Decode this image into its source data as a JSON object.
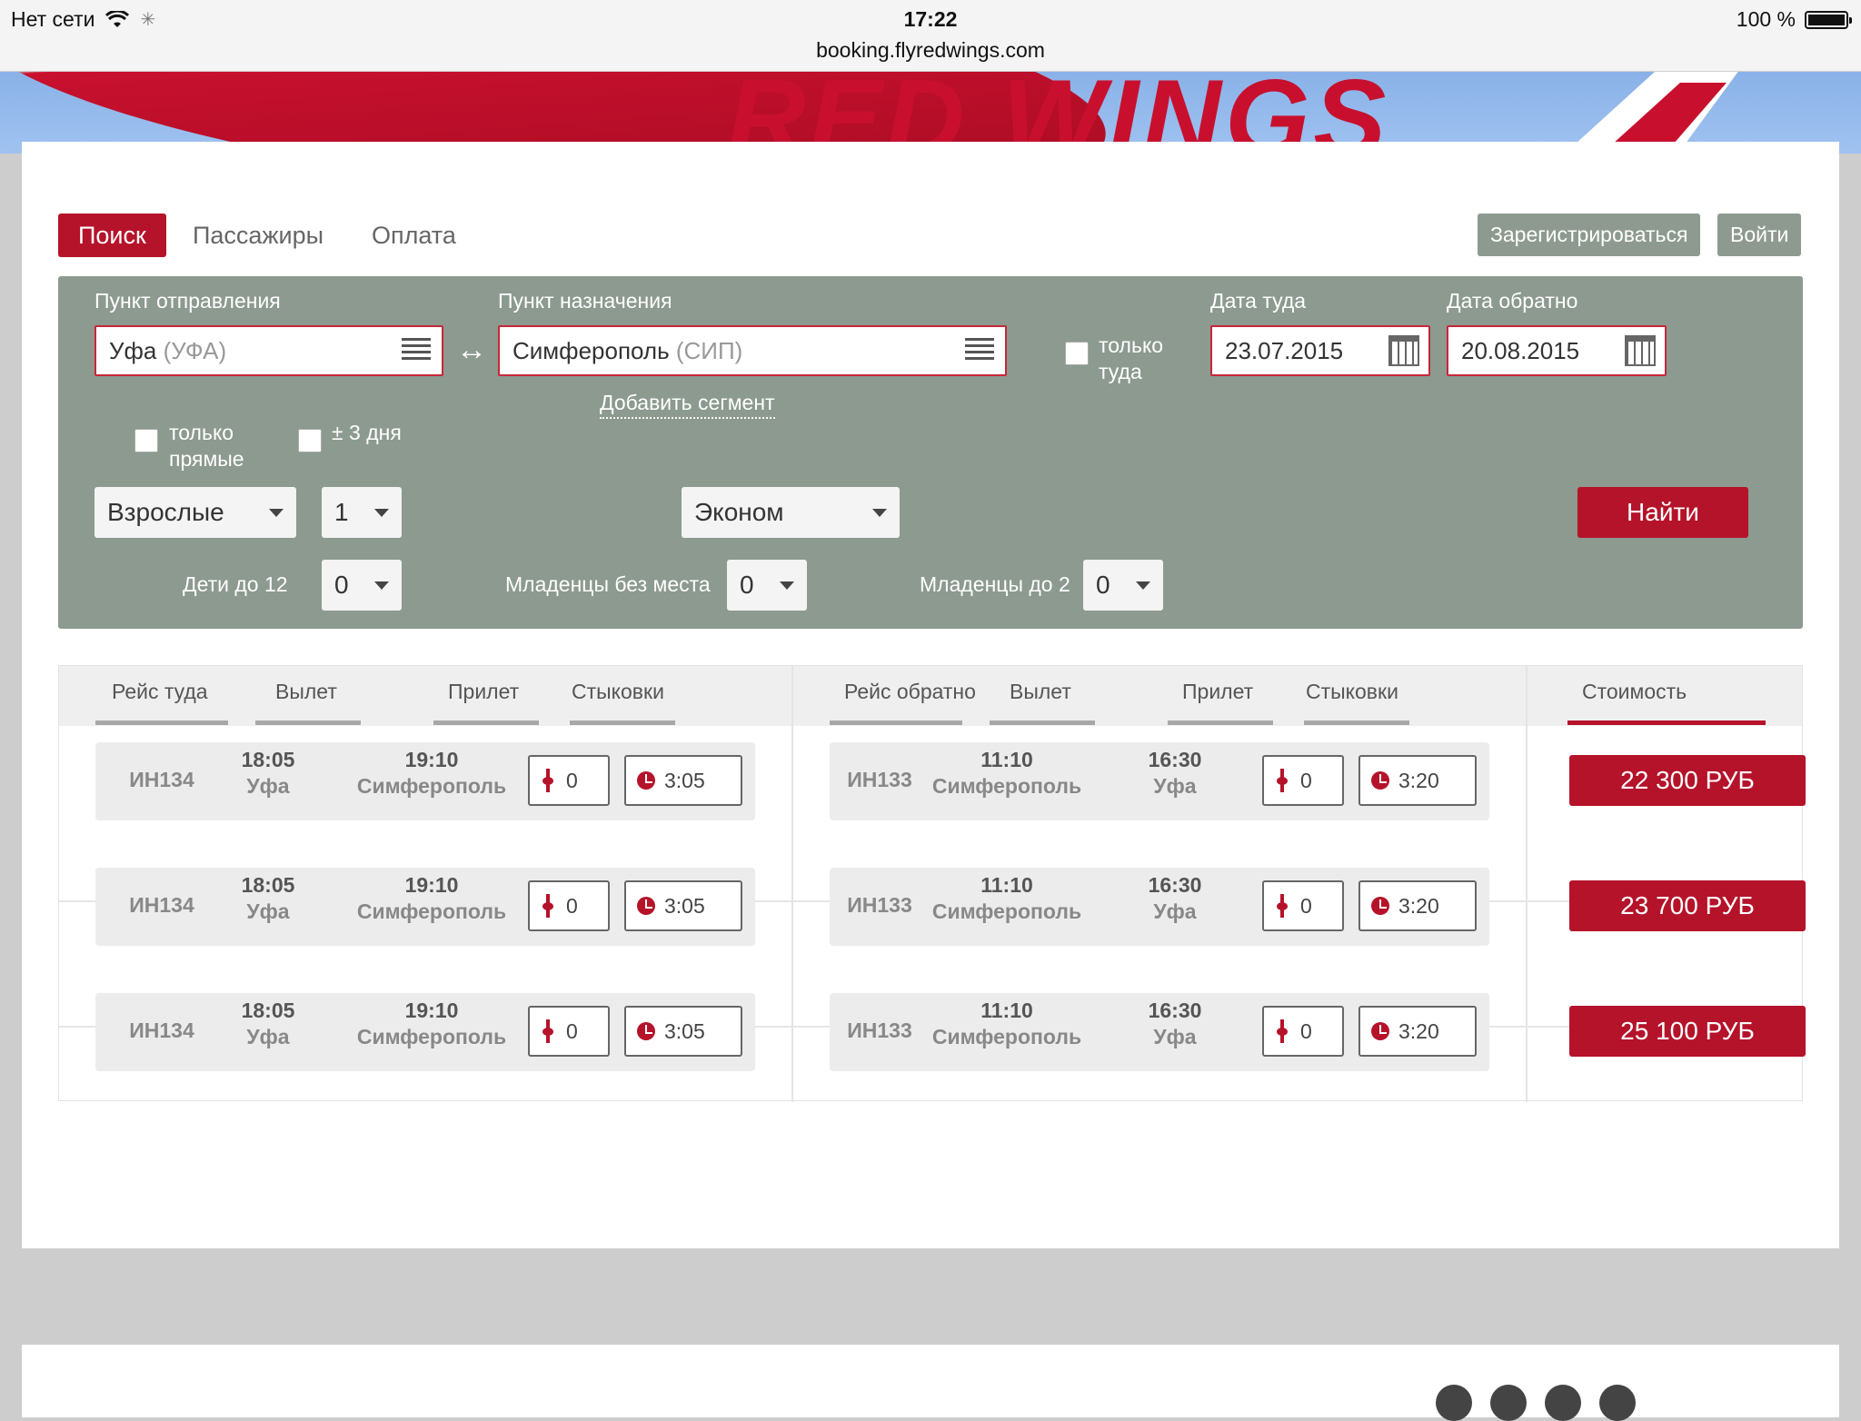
{
  "status_bar": {
    "carrier": "Нет сети",
    "time": "17:22",
    "url": "booking.flyredwings.com",
    "battery": "100 %"
  },
  "hero": {
    "brand": "RED WINGS"
  },
  "nav": {
    "tabs": [
      {
        "label": "Поиск",
        "active": true
      },
      {
        "label": "Пассажиры",
        "active": false
      },
      {
        "label": "Оплата",
        "active": false
      }
    ],
    "register_label": "Зарегистрироваться",
    "login_label": "Войти"
  },
  "search": {
    "origin_label": "Пункт отправления",
    "origin_city": "Уфа",
    "origin_code": "(УФА)",
    "destination_label": "Пункт назначения",
    "destination_city": "Симферополь",
    "destination_code": "(СИП)",
    "swap_icon": "↔",
    "one_way_line1": "только",
    "one_way_line2": "туда",
    "depart_label": "Дата туда",
    "depart_date": "23.07.2015",
    "return_label": "Дата обратно",
    "return_date": "20.08.2015",
    "add_segment": "Добавить сегмент",
    "direct_line1": "только",
    "direct_line2": "прямые",
    "flex_days": "± 3 дня",
    "pax_type": "Взрослые",
    "adults": "1",
    "cabin": "Эконом",
    "find_label": "Найти",
    "children_label": "Дети до 12",
    "children": "0",
    "infants_no_seat_label": "Младенцы без места",
    "infants_no_seat": "0",
    "infants_label": "Младенцы до 2",
    "infants": "0"
  },
  "results": {
    "outbound_headers": [
      "Рейс туда",
      "Вылет",
      "Прилет",
      "Стыковки"
    ],
    "return_headers": [
      "Рейс обратно",
      "Вылет",
      "Прилет",
      "Стыковки"
    ],
    "price_header": "Стоимость",
    "rows": [
      {
        "out": {
          "flight": "ИН134",
          "dep_time": "18:05",
          "dep_city": "Уфа",
          "arr_time": "19:10",
          "arr_city": "Симферополь",
          "stops": "0",
          "duration": "3:05"
        },
        "ret": {
          "flight": "ИН133",
          "dep_time": "11:10",
          "dep_city": "Симферополь",
          "arr_time": "16:30",
          "arr_city": "Уфа",
          "stops": "0",
          "duration": "3:20"
        },
        "price": "22 300 РУБ"
      },
      {
        "out": {
          "flight": "ИН134",
          "dep_time": "18:05",
          "dep_city": "Уфа",
          "arr_time": "19:10",
          "arr_city": "Симферополь",
          "stops": "0",
          "duration": "3:05"
        },
        "ret": {
          "flight": "ИН133",
          "dep_time": "11:10",
          "dep_city": "Симферополь",
          "arr_time": "16:30",
          "arr_city": "Уфа",
          "stops": "0",
          "duration": "3:20"
        },
        "price": "23 700 РУБ"
      },
      {
        "out": {
          "flight": "ИН134",
          "dep_time": "18:05",
          "dep_city": "Уфа",
          "arr_time": "19:10",
          "arr_city": "Симферополь",
          "stops": "0",
          "duration": "3:05"
        },
        "ret": {
          "flight": "ИН133",
          "dep_time": "11:10",
          "dep_city": "Симферополь",
          "arr_time": "16:30",
          "arr_city": "Уфа",
          "stops": "0",
          "duration": "3:20"
        },
        "price": "25 100 РУБ"
      }
    ]
  }
}
